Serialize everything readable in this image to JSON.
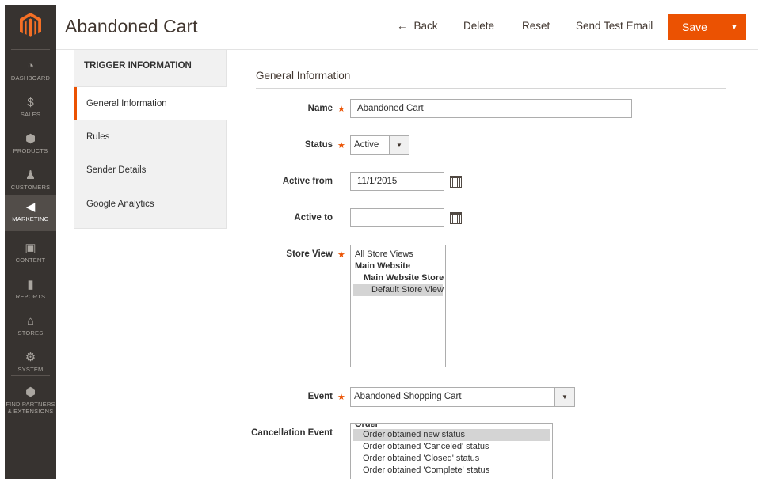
{
  "sidebar": {
    "items": [
      {
        "label": "Dashboard",
        "icon": "gauge-icon",
        "glyph": "◔"
      },
      {
        "label": "Sales",
        "icon": "dollar-icon",
        "glyph": "$"
      },
      {
        "label": "Products",
        "icon": "box-icon",
        "glyph": "⬢"
      },
      {
        "label": "Customers",
        "icon": "person-icon",
        "glyph": "♟"
      },
      {
        "label": "Marketing",
        "icon": "megaphone-icon",
        "glyph": "◀"
      },
      {
        "label": "Content",
        "icon": "layout-icon",
        "glyph": "▣"
      },
      {
        "label": "Reports",
        "icon": "bar-chart-icon",
        "glyph": "▮"
      },
      {
        "label": "Stores",
        "icon": "storefront-icon",
        "glyph": "⌂"
      },
      {
        "label": "System",
        "icon": "gear-icon",
        "glyph": "⚙"
      },
      {
        "label": "Find Partners\n& Extensions",
        "icon": "cube-icon",
        "glyph": "⬢"
      }
    ],
    "active": "Marketing"
  },
  "header": {
    "title": "Abandoned Cart",
    "back_label": "Back",
    "back_arrow": "←",
    "delete_label": "Delete",
    "reset_label": "Reset",
    "send_test_email_label": "Send Test Email",
    "save_label": "Save",
    "save_caret": "▼"
  },
  "subnav": {
    "title": "TRIGGER INFORMATION",
    "items": [
      "General Information",
      "Rules",
      "Sender Details",
      "Google Analytics"
    ],
    "active": "General Information"
  },
  "form": {
    "section_title": "General Information",
    "required_mark": "★",
    "name_label": "Name",
    "name_value": "Abandoned Cart",
    "status_label": "Status",
    "status_value": "Active",
    "active_from_label": "Active from",
    "active_from_value": "11/1/2015",
    "active_to_label": "Active to",
    "active_to_value": "",
    "store_view_label": "Store View",
    "store_view_options": [
      "All Store Views",
      "Main Website",
      "Main Website Store",
      "Default Store View"
    ],
    "store_view_selected": "Default Store View",
    "event_label": "Event",
    "event_value": "Abandoned Shopping Cart",
    "cancellation_event_label": "Cancellation Event",
    "cancellation_event_group": "Order",
    "cancellation_event_options": [
      "Order obtained new status",
      "Order obtained 'Canceled' status",
      "Order obtained 'Closed' status",
      "Order obtained 'Complete' status"
    ],
    "cancellation_event_selected": "Order obtained new status",
    "arrow_glyph": "▼"
  },
  "colors": {
    "accent": "#eb5202",
    "sidebar_bg": "#373330",
    "sidebar_active_bg": "#524d49"
  }
}
